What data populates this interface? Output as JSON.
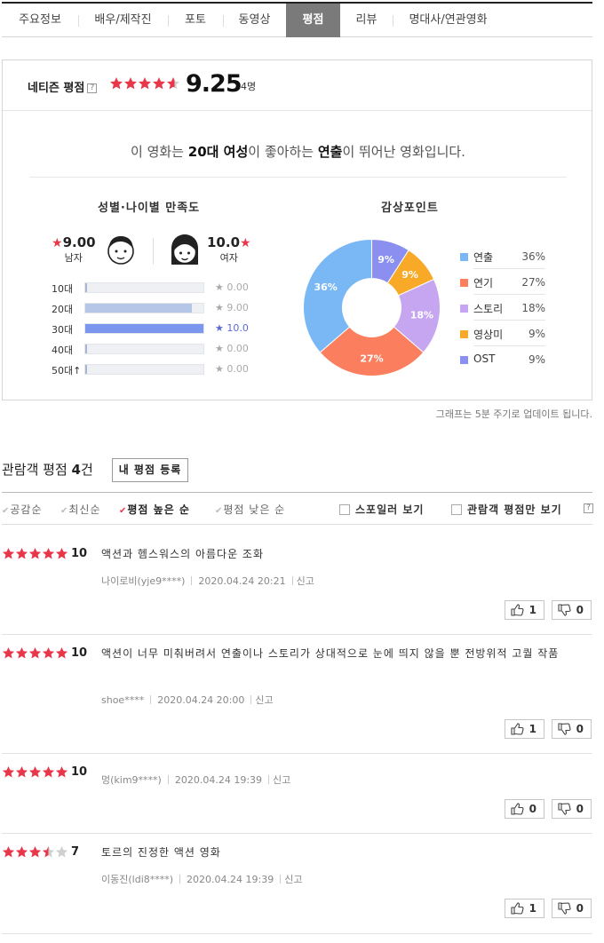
{
  "tabs": [
    {
      "label": "주요정보"
    },
    {
      "label": "배우/제작진"
    },
    {
      "label": "포토"
    },
    {
      "label": "동영상"
    },
    {
      "label": "평점",
      "active": true
    },
    {
      "label": "리뷰"
    },
    {
      "label": "명대사/연관영화"
    }
  ],
  "netizen": {
    "label": "네티즌 평점",
    "help": "?",
    "score": "9.25",
    "score_value": 9.25,
    "count": "4명"
  },
  "summary": {
    "pre": "이 영화는 ",
    "group": "20대 여성",
    "mid": "이 좋아하는 ",
    "point": "연출",
    "post": "이 뛰어난 영화입니다."
  },
  "demographics": {
    "title": "성별·나이별 만족도",
    "male": {
      "score": "9.00",
      "label": "남자"
    },
    "female": {
      "score": "10.0",
      "label": "여자"
    },
    "ages": [
      {
        "label": "10대",
        "value": 0.0,
        "display": "0.00"
      },
      {
        "label": "20대",
        "value": 9.0,
        "display": "9.00"
      },
      {
        "label": "30대",
        "value": 10.0,
        "display": "10.0",
        "top": true
      },
      {
        "label": "40대",
        "value": 0.0,
        "display": "0.00"
      },
      {
        "label": "50대↑",
        "value": 0.0,
        "display": "0.00"
      }
    ]
  },
  "points": {
    "title": "감상포인트",
    "colors": {
      "direction": "#7ab8f5",
      "acting": "#fb7f5e",
      "story": "#c6a6f0",
      "visual": "#f8a928",
      "ost": "#8a8ff0"
    }
  },
  "chart_data": {
    "type": "pie",
    "title": "감상포인트",
    "categories": [
      "연출",
      "연기",
      "스토리",
      "영상미",
      "OST"
    ],
    "values": [
      36,
      27,
      18,
      9,
      9
    ],
    "colors": [
      "#7ab8f5",
      "#fb7f5e",
      "#c6a6f0",
      "#f8a928",
      "#8a8ff0"
    ],
    "labels": [
      "36%",
      "27%",
      "18%",
      "9%",
      "9%"
    ],
    "donut": true,
    "legend": "right"
  },
  "update_note": "그래프는 5분 주기로 업데이트 됩니다.",
  "audience": {
    "title_pre": "관람객 평점 ",
    "count": "4",
    "title_post": "건",
    "register": "내 평점 등록",
    "sorts": [
      "공감순",
      "최신순",
      "평점 높은 순",
      "평점 낮은 순"
    ],
    "active_sort": 2,
    "spoiler": "스포일러 보기",
    "audience_only": "관람객 평점만 보기",
    "help": "?"
  },
  "reviews": [
    {
      "stars": 5,
      "score": "10",
      "text": "액션과 헴스워스의 아름다운 조화",
      "user": "나이로비(yje9****)",
      "date": "2020.04.24 20:21",
      "report": "신고",
      "likes": "1",
      "dislikes": "0"
    },
    {
      "stars": 5,
      "score": "10",
      "text": "액션이 너무 미춰버려서 연출이나 스토리가 상대적으로 눈에 띄지 않을 뿐 전방위적 고퀄 작품",
      "user": "shoe****",
      "date": "2020.04.24 20:00",
      "report": "신고",
      "likes": "1",
      "dislikes": "0"
    },
    {
      "stars": 5,
      "score": "10",
      "text": "",
      "user": "멍(kim9****)",
      "date": "2020.04.24 19:39",
      "report": "신고",
      "likes": "0",
      "dislikes": "0"
    },
    {
      "stars": 3.5,
      "score": "7",
      "text": "토르의 진정한 액션 영화",
      "user": "이동진(ldi8****)",
      "date": "2020.04.24 19:39",
      "report": "신고",
      "likes": "1",
      "dislikes": "0"
    }
  ]
}
